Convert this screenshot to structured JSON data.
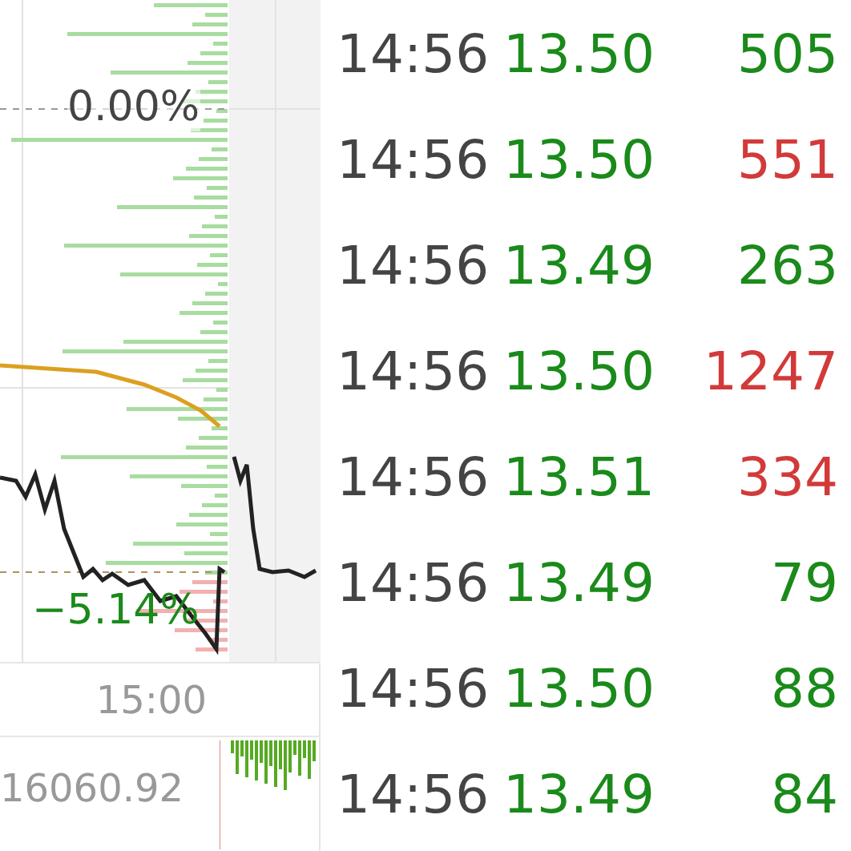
{
  "chart": {
    "zero_label": "0.00%",
    "low_label": "−5.14%",
    "time_label": "15:00",
    "volume_label": "16060.92"
  },
  "trades": [
    {
      "time": "14:56",
      "price": "13.50",
      "volume": "505",
      "color": "#1a8a1a"
    },
    {
      "time": "14:56",
      "price": "13.50",
      "volume": "551",
      "color": "#d23a3a"
    },
    {
      "time": "14:56",
      "price": "13.49",
      "volume": "263",
      "color": "#1a8a1a"
    },
    {
      "time": "14:56",
      "price": "13.50",
      "volume": "1247",
      "color": "#d23a3a"
    },
    {
      "time": "14:56",
      "price": "13.51",
      "volume": "334",
      "color": "#d23a3a"
    },
    {
      "time": "14:56",
      "price": "13.49",
      "volume": "79",
      "color": "#1a8a1a"
    },
    {
      "time": "14:56",
      "price": "13.50",
      "volume": "88",
      "color": "#1a8a1a"
    },
    {
      "time": "14:56",
      "price": "13.49",
      "volume": "84",
      "color": "#1a8a1a"
    }
  ]
}
